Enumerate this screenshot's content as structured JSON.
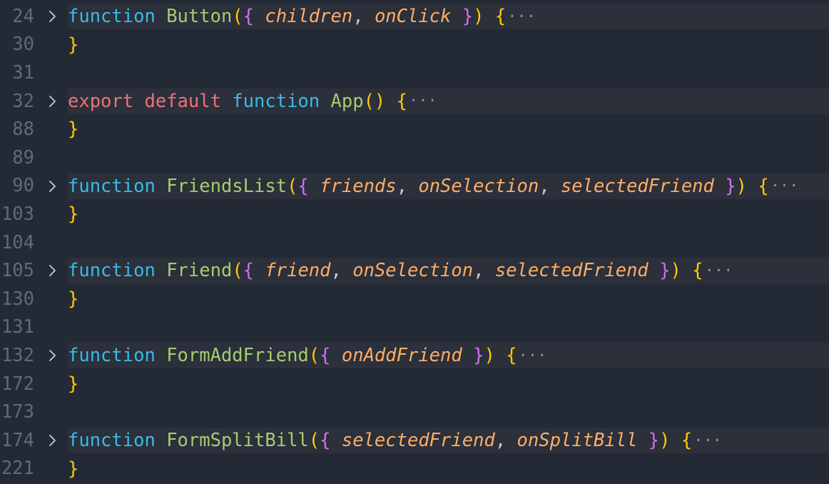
{
  "editor": {
    "lines": [
      {
        "num": "24",
        "folded": true,
        "tokens": [
          {
            "t": "function",
            "c": "kw"
          },
          {
            "t": " ",
            "c": "pun"
          },
          {
            "t": "Button",
            "c": "fn"
          },
          {
            "t": "(",
            "c": "p1"
          },
          {
            "t": "{",
            "c": "p2"
          },
          {
            "t": " ",
            "c": "pun"
          },
          {
            "t": "children",
            "c": "par"
          },
          {
            "t": ", ",
            "c": "pun"
          },
          {
            "t": "onClick",
            "c": "par"
          },
          {
            "t": " ",
            "c": "pun"
          },
          {
            "t": "}",
            "c": "p2"
          },
          {
            "t": ")",
            "c": "p1"
          },
          {
            "t": " ",
            "c": "pun"
          },
          {
            "t": "{",
            "c": "p1"
          }
        ]
      },
      {
        "num": "30",
        "folded": false,
        "tokens": [
          {
            "t": "}",
            "c": "p1"
          }
        ]
      },
      {
        "num": "31",
        "folded": false,
        "tokens": []
      },
      {
        "num": "32",
        "folded": true,
        "tokens": [
          {
            "t": "export",
            "c": "ex"
          },
          {
            "t": " ",
            "c": "pun"
          },
          {
            "t": "default",
            "c": "ex"
          },
          {
            "t": " ",
            "c": "pun"
          },
          {
            "t": "function",
            "c": "kw"
          },
          {
            "t": " ",
            "c": "pun"
          },
          {
            "t": "App",
            "c": "fn"
          },
          {
            "t": "()",
            "c": "p1"
          },
          {
            "t": " ",
            "c": "pun"
          },
          {
            "t": "{",
            "c": "p1"
          }
        ]
      },
      {
        "num": "88",
        "folded": false,
        "tokens": [
          {
            "t": "}",
            "c": "p1"
          }
        ]
      },
      {
        "num": "89",
        "folded": false,
        "tokens": []
      },
      {
        "num": "90",
        "folded": true,
        "tokens": [
          {
            "t": "function",
            "c": "kw"
          },
          {
            "t": " ",
            "c": "pun"
          },
          {
            "t": "FriendsList",
            "c": "fn"
          },
          {
            "t": "(",
            "c": "p1"
          },
          {
            "t": "{",
            "c": "p2"
          },
          {
            "t": " ",
            "c": "pun"
          },
          {
            "t": "friends",
            "c": "par"
          },
          {
            "t": ", ",
            "c": "pun"
          },
          {
            "t": "onSelection",
            "c": "par"
          },
          {
            "t": ", ",
            "c": "pun"
          },
          {
            "t": "selectedFriend",
            "c": "par"
          },
          {
            "t": " ",
            "c": "pun"
          },
          {
            "t": "}",
            "c": "p2"
          },
          {
            "t": ")",
            "c": "p1"
          },
          {
            "t": " ",
            "c": "pun"
          },
          {
            "t": "{",
            "c": "p1"
          }
        ]
      },
      {
        "num": "103",
        "folded": false,
        "tokens": [
          {
            "t": "}",
            "c": "p1"
          }
        ]
      },
      {
        "num": "104",
        "folded": false,
        "tokens": []
      },
      {
        "num": "105",
        "folded": true,
        "tokens": [
          {
            "t": "function",
            "c": "kw"
          },
          {
            "t": " ",
            "c": "pun"
          },
          {
            "t": "Friend",
            "c": "fn"
          },
          {
            "t": "(",
            "c": "p1"
          },
          {
            "t": "{",
            "c": "p2"
          },
          {
            "t": " ",
            "c": "pun"
          },
          {
            "t": "friend",
            "c": "par"
          },
          {
            "t": ", ",
            "c": "pun"
          },
          {
            "t": "onSelection",
            "c": "par"
          },
          {
            "t": ", ",
            "c": "pun"
          },
          {
            "t": "selectedFriend",
            "c": "par"
          },
          {
            "t": " ",
            "c": "pun"
          },
          {
            "t": "}",
            "c": "p2"
          },
          {
            "t": ")",
            "c": "p1"
          },
          {
            "t": " ",
            "c": "pun"
          },
          {
            "t": "{",
            "c": "p1"
          }
        ]
      },
      {
        "num": "130",
        "folded": false,
        "tokens": [
          {
            "t": "}",
            "c": "p1"
          }
        ]
      },
      {
        "num": "131",
        "folded": false,
        "tokens": []
      },
      {
        "num": "132",
        "folded": true,
        "tokens": [
          {
            "t": "function",
            "c": "kw"
          },
          {
            "t": " ",
            "c": "pun"
          },
          {
            "t": "FormAddFriend",
            "c": "fn"
          },
          {
            "t": "(",
            "c": "p1"
          },
          {
            "t": "{",
            "c": "p2"
          },
          {
            "t": " ",
            "c": "pun"
          },
          {
            "t": "onAddFriend",
            "c": "par"
          },
          {
            "t": " ",
            "c": "pun"
          },
          {
            "t": "}",
            "c": "p2"
          },
          {
            "t": ")",
            "c": "p1"
          },
          {
            "t": " ",
            "c": "pun"
          },
          {
            "t": "{",
            "c": "p1"
          }
        ]
      },
      {
        "num": "172",
        "folded": false,
        "tokens": [
          {
            "t": "}",
            "c": "p1"
          }
        ]
      },
      {
        "num": "173",
        "folded": false,
        "tokens": []
      },
      {
        "num": "174",
        "folded": true,
        "tokens": [
          {
            "t": "function",
            "c": "kw"
          },
          {
            "t": " ",
            "c": "pun"
          },
          {
            "t": "FormSplitBill",
            "c": "fn"
          },
          {
            "t": "(",
            "c": "p1"
          },
          {
            "t": "{",
            "c": "p2"
          },
          {
            "t": " ",
            "c": "pun"
          },
          {
            "t": "selectedFriend",
            "c": "par"
          },
          {
            "t": ", ",
            "c": "pun"
          },
          {
            "t": "onSplitBill",
            "c": "par"
          },
          {
            "t": " ",
            "c": "pun"
          },
          {
            "t": "}",
            "c": "p2"
          },
          {
            "t": ")",
            "c": "p1"
          },
          {
            "t": " ",
            "c": "pun"
          },
          {
            "t": "{",
            "c": "p1"
          }
        ]
      },
      {
        "num": "221",
        "folded": false,
        "tokens": [
          {
            "t": "}",
            "c": "p1"
          }
        ]
      }
    ],
    "ellipsis": "···",
    "fold_icon": "chevron-right-icon"
  },
  "colors": {
    "background": "#242936",
    "folded_line_bg": "#2b303b",
    "keyword": "#39bae6",
    "export_keyword": "#f07178",
    "function_name": "#a6cc70",
    "bracket_level1": "#ffcc00",
    "bracket_level2": "#d36ef2",
    "parameter": "#ffad66",
    "line_number": "#5f6a7d"
  }
}
